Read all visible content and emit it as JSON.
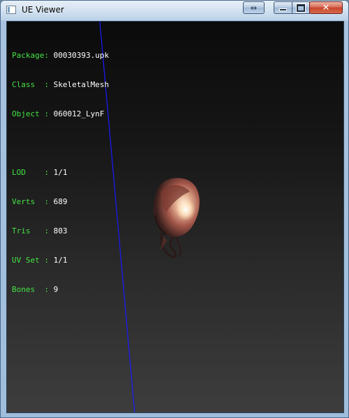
{
  "window": {
    "title": "UE Viewer",
    "close_glyph": "✕",
    "swap_glyph": "⇔"
  },
  "info": {
    "rows": [
      {
        "label": "Package: ",
        "value": "00030393.upk"
      },
      {
        "label": "Class  : ",
        "value": "SkeletalMesh"
      },
      {
        "label": "Object : ",
        "value": "060012_LynF"
      }
    ],
    "stats": [
      {
        "label": "LOD    : ",
        "value": "1/1"
      },
      {
        "label": "Verts  : ",
        "value": "689"
      },
      {
        "label": "Tris   : ",
        "value": "803"
      },
      {
        "label": "UV Set : ",
        "value": "1/1"
      },
      {
        "label": "Bones  : ",
        "value": "9"
      }
    ]
  },
  "colors": {
    "label_green": "#44e244",
    "axis_blue": "#1a1aff"
  }
}
